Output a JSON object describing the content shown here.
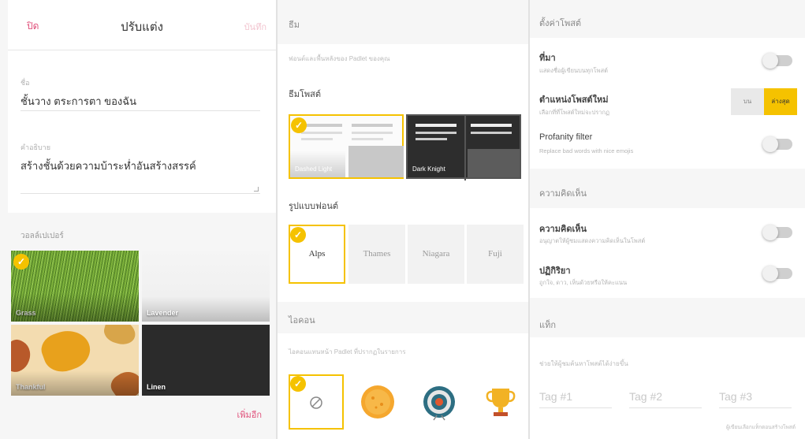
{
  "customize_panel": {
    "back_label": "ปิด",
    "title": "ปรับแต่ง",
    "save_label": "บันทึก",
    "name_label": "ชื่อ",
    "name_value": "ชั้นวาง ตระการตา ของฉัน",
    "description_label": "คำอธิบาย",
    "description_value": "สร้างชั้นด้วยความบ้าระห่ำอันสร้างสรรค์",
    "wallpaper_label": "วอลล์เปเปอร์",
    "wallpapers": [
      {
        "name": "Grass",
        "selected": true
      },
      {
        "name": "Lavender",
        "selected": false
      },
      {
        "name": "Thankful",
        "selected": false
      },
      {
        "name": "Linen",
        "selected": false
      }
    ],
    "apply_label": "เพิ่มอีก"
  },
  "appearance_panel": {
    "header": "ธีม",
    "header_hint": "ฟอนต์และพื้นหลังของ Padlet ของคุณ",
    "theme_label": "ธีมโพสต์",
    "themes": [
      {
        "name": "Dashed Light",
        "selected": true
      },
      {
        "name": "Dark Knight",
        "selected": false
      }
    ],
    "font_label": "รูปแบบฟอนต์",
    "fonts": [
      {
        "name": "Alps",
        "selected": true
      },
      {
        "name": "Thames",
        "selected": false
      },
      {
        "name": "Niagara",
        "selected": false
      },
      {
        "name": "Fuji",
        "selected": false
      }
    ],
    "icon_label": "ไอคอน",
    "icon_hint": "ไอคอนแทนหน้า Padlet ที่ปรากฏในรายการ",
    "icons": [
      "none-icon",
      "orange-icon",
      "target-icon",
      "trophy-icon"
    ]
  },
  "settings_panel": {
    "post_settings_header": "ตั้งค่าโพสต์",
    "settings": [
      {
        "title": "ที่มา",
        "desc": "แสดงชื่อผู้เขียนบนทุกโพสต์",
        "type": "toggle",
        "on": false
      },
      {
        "title": "ตำแหน่งโพสต์ใหม่",
        "desc": "เลือกที่ที่โพสต์ใหม่จะปรากฏ",
        "type": "segment",
        "options": [
          "บน",
          "ล่างสุด"
        ],
        "active": 1
      },
      {
        "title": "Profanity filter",
        "desc": "Replace bad words with nice emojis",
        "type": "toggle",
        "on": false
      }
    ],
    "engagement_header": "ความคิดเห็น",
    "engagement": [
      {
        "title": "ความคิดเห็น",
        "desc": "อนุญาตให้ผู้ชมแสดงความคิดเห็นในโพสต์",
        "on": false
      },
      {
        "title": "ปฏิกิริยา",
        "desc": "ถูกใจ, ดาว, เห็นด้วยหรือให้คะแนน",
        "on": false
      }
    ],
    "tags_header": "แท็ก",
    "tags_hint": "ช่วยให้ผู้ชมค้นหาโพสต์ได้ง่ายขึ้น",
    "tags": [
      "Tag #1",
      "Tag #2",
      "Tag #3"
    ],
    "tags_note": "ผู้เขียนเลือกแท็กตอนสร้างโพสต์"
  },
  "colors": {
    "accent": "#f5c200",
    "link": "#e0507a"
  }
}
